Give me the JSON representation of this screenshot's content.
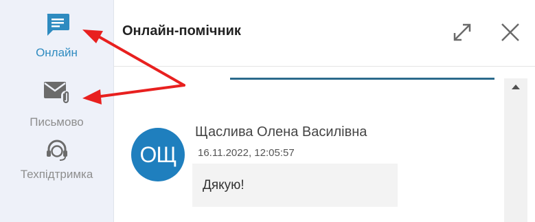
{
  "sidebar": {
    "items": [
      {
        "label": "Онлайн",
        "icon": "chat-icon",
        "active": true
      },
      {
        "label": "Письмово",
        "icon": "mail-attachment-icon",
        "active": false
      },
      {
        "label": "Техпідтримка",
        "icon": "headset-icon",
        "active": false
      }
    ]
  },
  "header": {
    "title": "Онлайн-помічник",
    "expand_icon": "expand-icon",
    "close_icon": "close-icon"
  },
  "chat": {
    "message": {
      "avatar_initials": "ОЩ",
      "author": "Щаслива Олена Василівна",
      "timestamp": "16.11.2022, 12:05:57",
      "text": "Дякую!"
    }
  },
  "colors": {
    "accent": "#2e8bc0",
    "avatar": "#1f7fbe",
    "annotation_arrow": "#e8201f",
    "sidebar_bg": "#eef1f9"
  }
}
